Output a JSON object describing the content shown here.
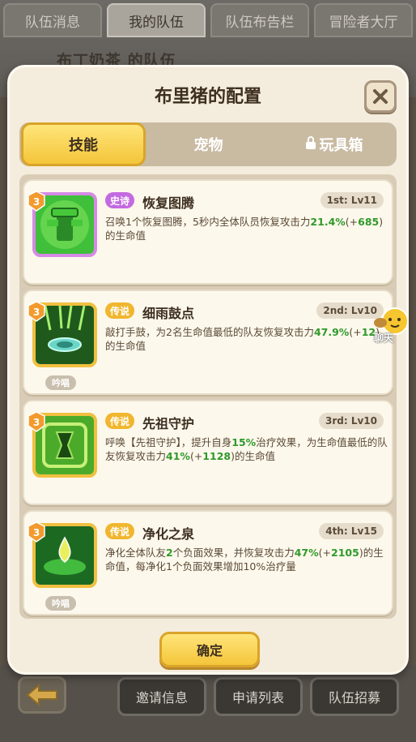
{
  "bg_tabs": [
    "队伍消息",
    "我的队伍",
    "队伍布告栏",
    "冒险者大厅"
  ],
  "bg_subtitle": "布丁奶茶 的队伍",
  "modal": {
    "title": "布里猪的配置",
    "tabs": [
      "技能",
      "宠物",
      "玩具箱"
    ],
    "confirm_label": "确定"
  },
  "skills": [
    {
      "rarity": "史诗",
      "name": "恢复图腾",
      "rank": "1st: Lv11",
      "level_badge": "3",
      "desc_parts": [
        "召唤1个恢复图腾，5秒内全体队员恢复攻击力",
        "21.4%",
        "(+",
        "685",
        ")的生命值"
      ],
      "chant": ""
    },
    {
      "rarity": "传说",
      "name": "细雨鼓点",
      "rank": "2nd: Lv10",
      "level_badge": "3",
      "desc_parts": [
        "敲打手鼓，为2名生命值最低的队友恢复攻击力",
        "47.9%",
        "(+",
        "12",
        ")的生命值"
      ],
      "chant": "吟唱"
    },
    {
      "rarity": "传说",
      "name": "先祖守护",
      "rank": "3rd: Lv10",
      "level_badge": "3",
      "desc_parts": [
        "呼唤【先祖守护】，提升自身",
        "15%",
        "治疗效果，为生命值最低的队友恢复攻击力",
        "41%",
        "(+",
        "1128",
        ")的生命值"
      ],
      "chant": ""
    },
    {
      "rarity": "传说",
      "name": "净化之泉",
      "rank": "4th: Lv15",
      "level_badge": "3",
      "desc_parts": [
        "净化全体队友",
        "2",
        "个负面效果，并恢复攻击力",
        "47%",
        "(+",
        "2105",
        ")的生命值，每净化1个负面效果增加10%治疗量"
      ],
      "chant": "吟唱"
    }
  ],
  "bottom_buttons": [
    "邀请信息",
    "申请列表",
    "队伍招募"
  ],
  "chat_label": "聊天",
  "colors": {
    "gold": "#f4c53a",
    "epic": "#c36ae0",
    "green_value": "#2e9a2a"
  }
}
